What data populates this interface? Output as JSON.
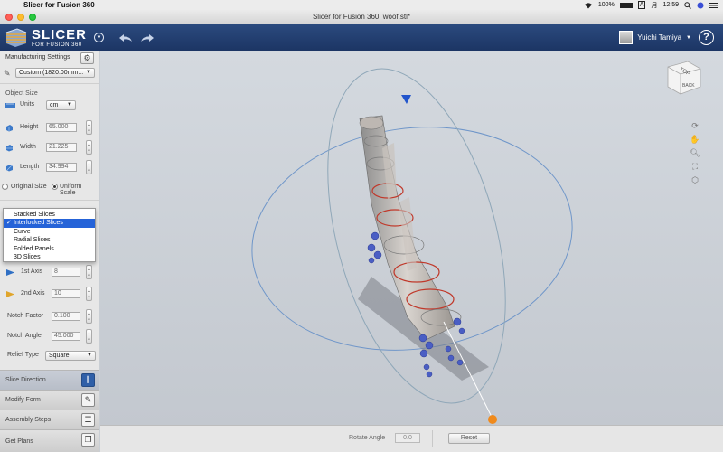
{
  "menubar": {
    "app_name": "Slicer for Fusion 360",
    "battery": "100%",
    "ime": "A",
    "weekday": "月",
    "time": "12:59"
  },
  "window": {
    "title": "Slicer for Fusion 360: woof.stl*"
  },
  "header": {
    "logo_big": "SLICER",
    "logo_small": "FOR FUSION 360",
    "user_name": "Yuichi Tamiya",
    "help": "?"
  },
  "sidebar": {
    "manufacturing_label": "Manufacturing Settings",
    "manufacturing_value": "Custom (1820.00mm...",
    "object_size_label": "Object Size",
    "units_label": "Units",
    "units_value": "cm",
    "height_label": "Height",
    "height_value": "65.000",
    "width_label": "Width",
    "width_value": "21.225",
    "length_label": "Length",
    "length_value": "34.994",
    "original_size_label": "Original Size",
    "uniform_scale_label": "Uniform Scale",
    "construction_options": [
      "Stacked Slices",
      "Interlocked Slices",
      "Curve",
      "Radial Slices",
      "Folded Panels",
      "3D Slices"
    ],
    "selected_option": "Interlocked Slices",
    "axis1_label": "1st Axis",
    "axis1_value": "8",
    "axis2_label": "2nd Axis",
    "axis2_value": "10",
    "notch_factor_label": "Notch Factor",
    "notch_factor_value": "0.100",
    "notch_angle_label": "Notch Angle",
    "notch_angle_value": "45.000",
    "relief_type_label": "Relief Type",
    "relief_type_value": "Square",
    "steps": [
      "Slice Direction",
      "Modify Form",
      "Assembly Steps",
      "Get Plans"
    ]
  },
  "viewcube": {
    "top": "TOP",
    "back": "BACK"
  },
  "bottombar": {
    "rotate_angle_label": "Rotate Angle",
    "rotate_angle_value": "0.0",
    "reset_label": "Reset"
  },
  "colors": {
    "header_bg": "#1f3a6b",
    "selection_blue": "#2563d8",
    "gizmo_orange": "#f08a1c",
    "slice_red": "#c0392b"
  }
}
